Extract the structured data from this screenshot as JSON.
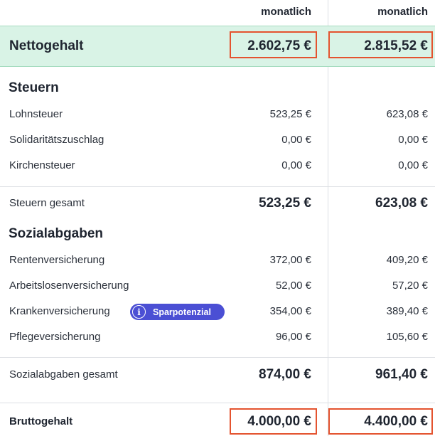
{
  "columns": {
    "col1_label": "monatlich",
    "col2_label": "monatlich"
  },
  "net": {
    "label": "Nettogehalt",
    "col1": "2.602,75 €",
    "col2": "2.815,52 €"
  },
  "taxes": {
    "title": "Steuern",
    "rows": [
      {
        "label": "Lohnsteuer",
        "col1": "523,25 €",
        "col2": "623,08 €"
      },
      {
        "label": "Solidaritätszuschlag",
        "col1": "0,00 €",
        "col2": "0,00 €"
      },
      {
        "label": "Kirchensteuer",
        "col1": "0,00 €",
        "col2": "0,00 €"
      }
    ],
    "total": {
      "label": "Steuern gesamt",
      "col1": "523,25 €",
      "col2": "623,08 €"
    }
  },
  "social": {
    "title": "Sozialabgaben",
    "rows": [
      {
        "label": "Rentenversicherung",
        "col1": "372,00 €",
        "col2": "409,20 €"
      },
      {
        "label": "Arbeitslosenversicherung",
        "col1": "52,00 €",
        "col2": "57,20 €"
      },
      {
        "label": "Krankenversicherung",
        "col1": "354,00 €",
        "col2": "389,40 €"
      },
      {
        "label": "Pflegeversicherung",
        "col1": "96,00 €",
        "col2": "105,60 €"
      }
    ],
    "badge": {
      "icon_glyph": "i",
      "label": "Sparpotenzial"
    },
    "total": {
      "label": "Sozialabgaben gesamt",
      "col1": "874,00 €",
      "col2": "961,40 €"
    }
  },
  "gross": {
    "label": "Bruttogehalt",
    "col1": "4.000,00 €",
    "col2": "4.400,00 €"
  },
  "colors": {
    "accent": "#e4532f",
    "net_band": "#d9f3e6",
    "badge": "#4b4fd4"
  }
}
